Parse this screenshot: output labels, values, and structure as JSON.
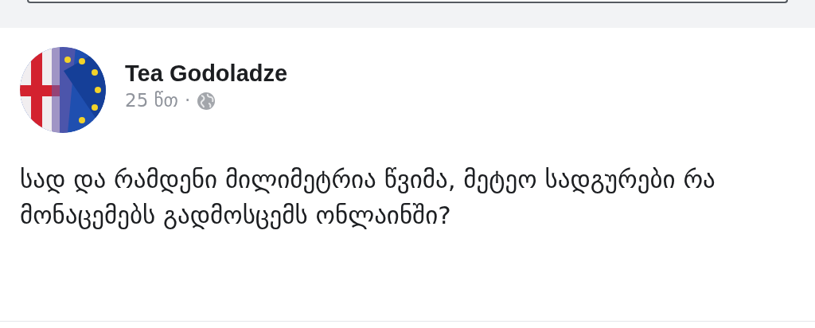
{
  "composer": {
    "kind": "field"
  },
  "post": {
    "author": "Tea Godoladze",
    "time": "25 წთ",
    "separator": "·",
    "text": "სად და რამდენი მილიმეტრია წვიმა, მეტეო სადგურები რა მონაცემებს გადმოსცემს ონლაინში?"
  }
}
